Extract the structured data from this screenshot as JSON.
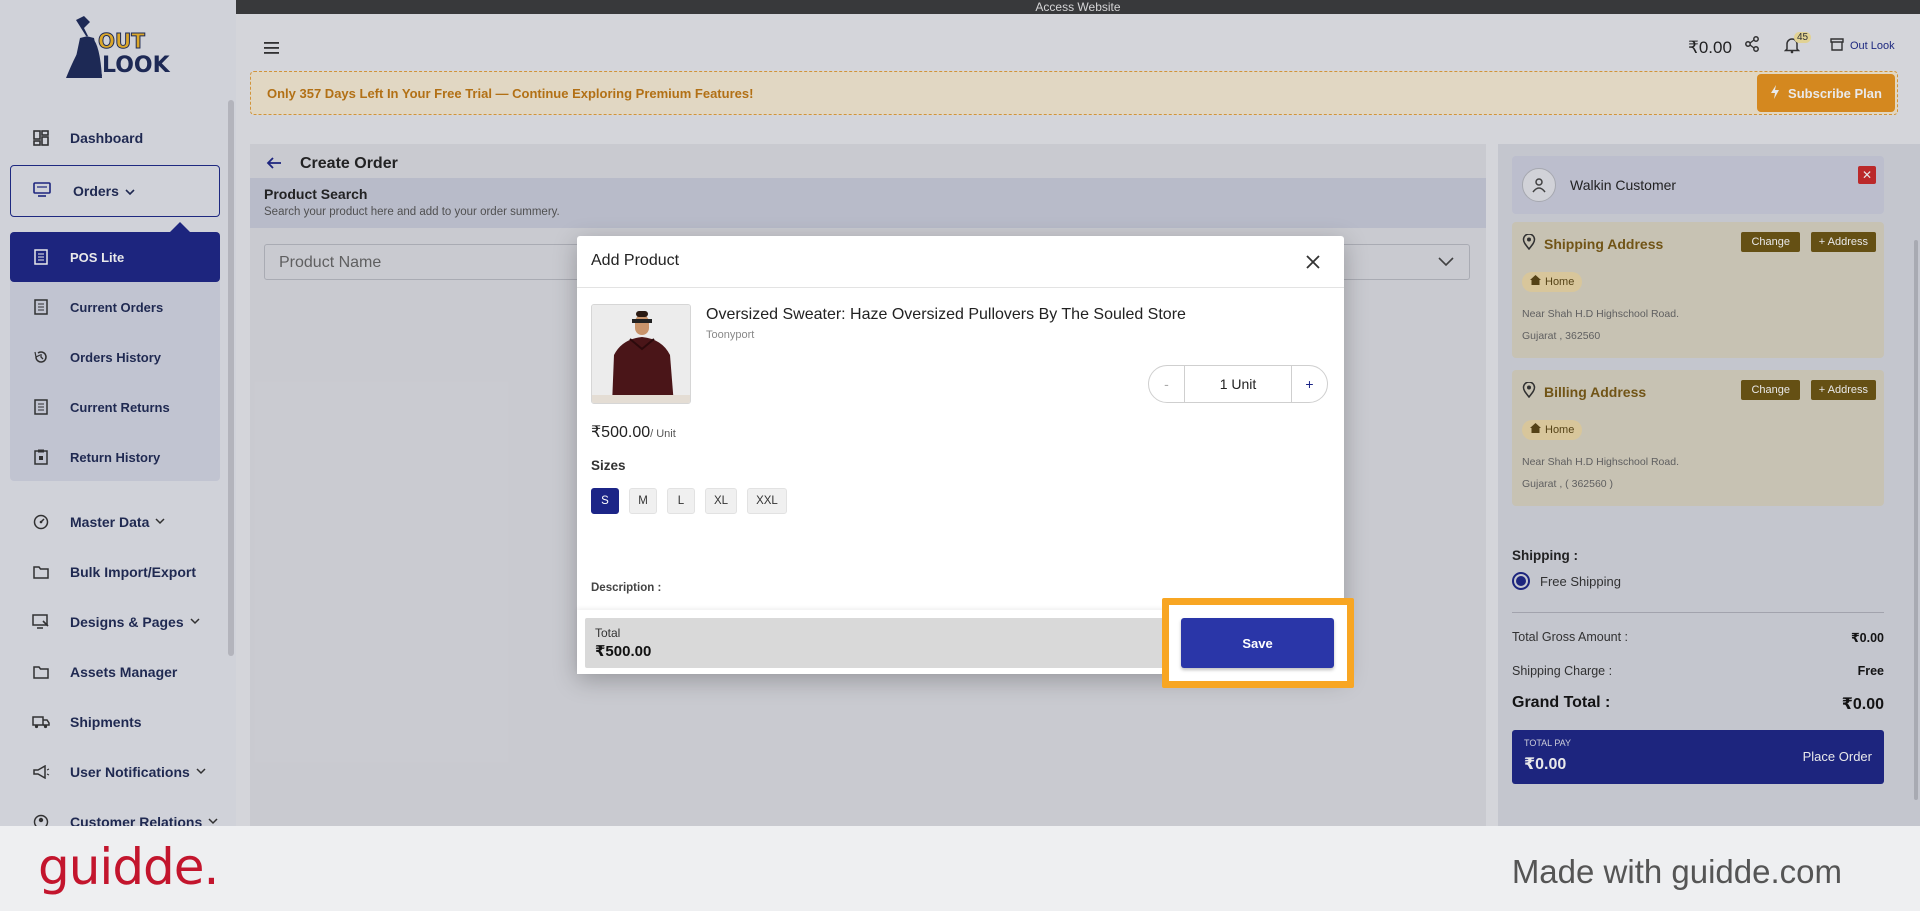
{
  "top_strip": {
    "text": "Access Website"
  },
  "brand": {
    "logo_text_top": "OUT",
    "logo_text_bottom": "LOOK"
  },
  "sidebar": {
    "items_top": [
      {
        "label": "Dashboard",
        "icon": "dashboard-icon"
      }
    ],
    "orders": {
      "label": "Orders",
      "icon": "monitor-icon"
    },
    "submenu": [
      {
        "label": "POS Lite",
        "icon": "list-icon",
        "active": true
      },
      {
        "label": "Current Orders",
        "icon": "list-icon"
      },
      {
        "label": "Orders History",
        "icon": "history-icon"
      },
      {
        "label": "Current Returns",
        "icon": "list-icon"
      },
      {
        "label": "Return History",
        "icon": "clipboard-icon"
      }
    ],
    "items": [
      {
        "label": "Master Data",
        "icon": "gauge-icon",
        "has_chevron": true
      },
      {
        "label": "Bulk Import/Export",
        "icon": "folder-icon"
      },
      {
        "label": "Designs & Pages",
        "icon": "design-icon",
        "has_chevron": true
      },
      {
        "label": "Assets Manager",
        "icon": "folder-icon"
      },
      {
        "label": "Shipments",
        "icon": "truck-icon"
      },
      {
        "label": "User Notifications",
        "icon": "megaphone-icon",
        "has_chevron": true
      },
      {
        "label": "Customer Relations",
        "icon": "customer-icon",
        "has_chevron": true
      }
    ]
  },
  "header": {
    "balance": "₹0.00",
    "notification_count": "45",
    "store_name": "Out Look"
  },
  "trial_banner": {
    "text": "Only 357 Days Left In Your Free Trial — Continue Exploring Premium Features!",
    "subscribe_label": "Subscribe Plan"
  },
  "create_order": {
    "title": "Create Order",
    "search_title": "Product Search",
    "search_subtitle": "Search your product here and add to your order summery.",
    "product_placeholder": "Product Name"
  },
  "customer_panel": {
    "customer_name": "Walkin Customer",
    "shipping_address": {
      "title": "Shipping Address",
      "change_label": "Change",
      "add_label": "+ Address",
      "tag": "Home",
      "line1": "Near Shah H.D Highschool Road.",
      "line2": "Gujarat , 362560"
    },
    "billing_address": {
      "title": "Billing Address",
      "change_label": "Change",
      "add_label": "+ Address",
      "tag": "Home",
      "line1": "Near Shah H.D Highschool Road.",
      "line2": "Gujarat , ( 362560 )"
    },
    "shipping_label": "Shipping :",
    "shipping_option": "Free Shipping",
    "summary": {
      "gross_label": "Total Gross Amount :",
      "gross_value": "₹0.00",
      "charge_label": "Shipping Charge :",
      "charge_value": "Free",
      "grand_label": "Grand Total :",
      "grand_value": "₹0.00"
    },
    "pay": {
      "label": "TOTAL PAY",
      "amount": "₹0.00",
      "button": "Place Order"
    }
  },
  "modal": {
    "title": "Add Product",
    "product_name": "Oversized Sweater: Haze Oversized Pullovers By The Souled Store",
    "brand": "Toonyport",
    "quantity": "1 Unit",
    "minus": "-",
    "plus": "+",
    "price": "₹500.00",
    "price_unit": "/ Unit",
    "sizes_label": "Sizes",
    "sizes": [
      "S",
      "M",
      "L",
      "XL",
      "XXL"
    ],
    "selected_size": "S",
    "description_label": "Description :",
    "total_label": "Total",
    "total_value": "₹500.00",
    "save_label": "Save"
  },
  "footer": {
    "logo": "guidde.",
    "made_with": "Made with guidde.com"
  },
  "colors": {
    "primary": "#1c2587",
    "highlight": "#f8a623",
    "trial": "#e8941d",
    "address_btn": "#6c5511",
    "brand_red": "#c3152d"
  }
}
